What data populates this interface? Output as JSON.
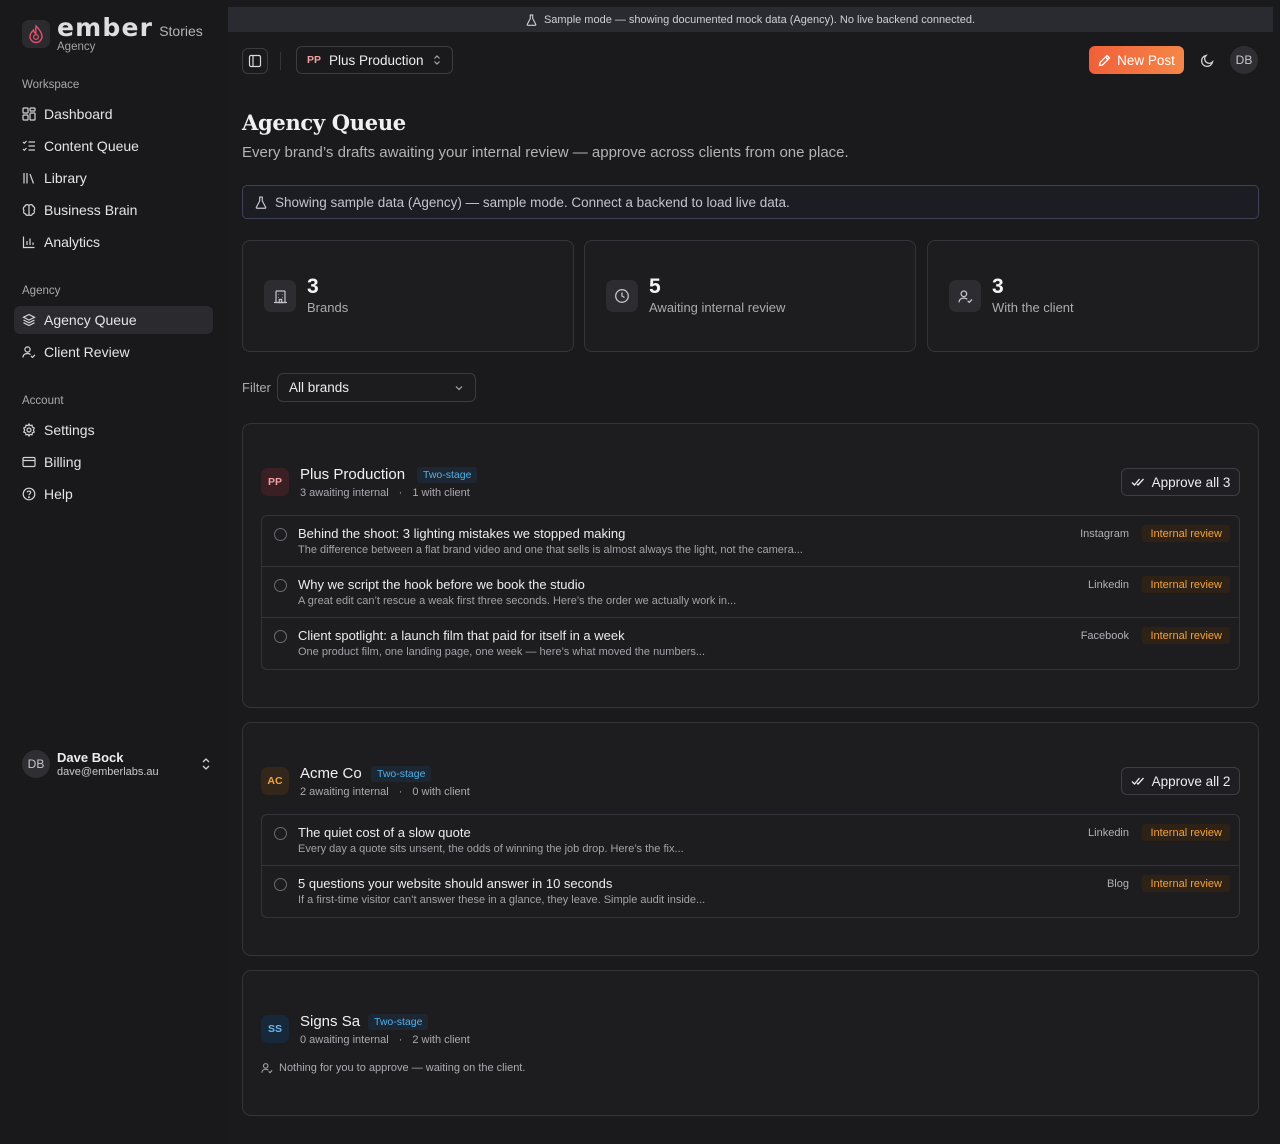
{
  "sidebar": {
    "brand_name": "ember",
    "brand_product": "Stories",
    "brand_sub": "Agency",
    "sections": [
      {
        "label": "Workspace",
        "items": [
          {
            "label": "Dashboard",
            "icon": "grid-icon"
          },
          {
            "label": "Content Queue",
            "icon": "list-check-icon"
          },
          {
            "label": "Library",
            "icon": "library-icon"
          },
          {
            "label": "Business Brain",
            "icon": "brain-icon"
          },
          {
            "label": "Analytics",
            "icon": "bar-chart-icon"
          }
        ]
      },
      {
        "label": "Agency",
        "items": [
          {
            "label": "Agency Queue",
            "icon": "layers-icon",
            "active": true
          },
          {
            "label": "Client Review",
            "icon": "user-check-icon"
          }
        ]
      },
      {
        "label": "Account",
        "items": [
          {
            "label": "Settings",
            "icon": "gear-icon"
          },
          {
            "label": "Billing",
            "icon": "credit-card-icon"
          },
          {
            "label": "Help",
            "icon": "help-circle-icon"
          }
        ]
      }
    ],
    "user": {
      "initials": "DB",
      "name": "Dave Bock",
      "email": "dave@emberlabs.au"
    }
  },
  "banner": {
    "text": "Sample mode — showing documented mock data (Agency). No live backend connected."
  },
  "topbar": {
    "brand_initials": "PP",
    "brand_label": "Plus Production",
    "new_post_label": "New Post",
    "avatar_initials": "DB"
  },
  "page": {
    "title": "Agency Queue",
    "subtitle": "Every brand’s drafts awaiting your internal review — approve across clients from one place.",
    "info": "Showing sample data (Agency) — sample mode. Connect a backend to load live data."
  },
  "stats": [
    {
      "value": "3",
      "label": "Brands",
      "icon": "building-icon"
    },
    {
      "value": "5",
      "label": "Awaiting internal review",
      "icon": "clock-icon"
    },
    {
      "value": "3",
      "label": "With the client",
      "icon": "user-check-icon"
    }
  ],
  "filter": {
    "label": "Filter",
    "value": "All brands"
  },
  "brands": [
    {
      "initials": "PP",
      "name": "Plus Production",
      "stage": "Two-stage",
      "awaiting": "3 awaiting internal",
      "with_client": "1 with client",
      "approve_label": "Approve all 3",
      "posts": [
        {
          "title": "Behind the shoot: 3 lighting mistakes we stopped making",
          "excerpt": "The difference between a flat brand video and one that sells is almost always the light, not the camera...",
          "platform": "Instagram",
          "status": "Internal review"
        },
        {
          "title": "Why we script the hook before we book the studio",
          "excerpt": "A great edit can’t rescue a weak first three seconds. Here’s the order we actually work in...",
          "platform": "Linkedin",
          "status": "Internal review"
        },
        {
          "title": "Client spotlight: a launch film that paid for itself in a week",
          "excerpt": "One product film, one landing page, one week — here’s what moved the numbers...",
          "platform": "Facebook",
          "status": "Internal review"
        }
      ]
    },
    {
      "initials": "AC",
      "name": "Acme Co",
      "stage": "Two-stage",
      "awaiting": "2 awaiting internal",
      "with_client": "0 with client",
      "approve_label": "Approve all 2",
      "posts": [
        {
          "title": "The quiet cost of a slow quote",
          "excerpt": "Every day a quote sits unsent, the odds of winning the job drop. Here’s the fix...",
          "platform": "Linkedin",
          "status": "Internal review"
        },
        {
          "title": "5 questions your website should answer in 10 seconds",
          "excerpt": "If a first-time visitor can’t answer these in a glance, they leave. Simple audit inside...",
          "platform": "Blog",
          "status": "Internal review"
        }
      ]
    },
    {
      "initials": "SS",
      "name": "Signs Sa",
      "stage": "Two-stage",
      "awaiting": "0 awaiting internal",
      "with_client": "2 with client",
      "empty_note": "Nothing for you to approve — waiting on the client."
    }
  ],
  "colors": {
    "accent": "#f26b3f",
    "status_internal": "#f4a23a",
    "stage_tag": "#4fb0e8",
    "badge_pp": "#f2a0a0",
    "badge_ac": "#f4a23a",
    "badge_ss": "#6cb8ec"
  }
}
